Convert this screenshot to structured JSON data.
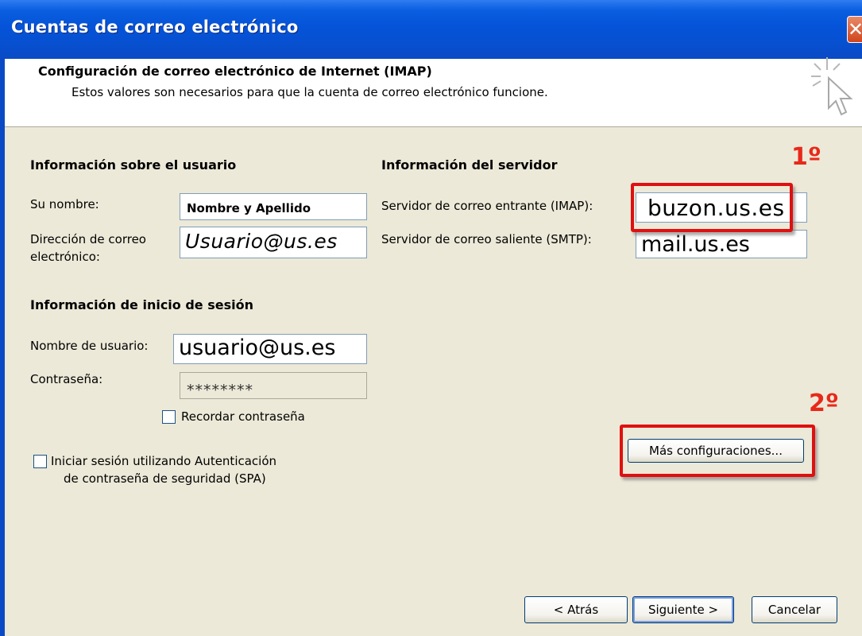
{
  "window": {
    "title": "Cuentas de correo electrónico",
    "close_label": "✕"
  },
  "header": {
    "title": "Configuración de correo electrónico de Internet (IMAP)",
    "subtitle": "Estos valores son necesarios para que la cuenta de correo electrónico funcione."
  },
  "user_info": {
    "heading": "Información sobre el usuario",
    "name_label": "Su nombre:",
    "name_value": "Nombre y Apellido",
    "email_label_line1": "Dirección de correo",
    "email_label_line2": "electrónico:",
    "email_value": "Usuario@us.es"
  },
  "server_info": {
    "heading": "Información del servidor",
    "incoming_label": "Servidor de correo entrante (IMAP):",
    "incoming_value": "buzon.us.es",
    "outgoing_label": "Servidor de correo saliente (SMTP):",
    "outgoing_value": "mail.us.es"
  },
  "login_info": {
    "heading": "Información de inicio de sesión",
    "username_label": "Nombre de usuario:",
    "username_value": "usuario@us.es",
    "password_label": "Contraseña:",
    "password_value": "********",
    "remember_label": "Recordar contraseña"
  },
  "spa": {
    "label_line1": "Iniciar sesión utilizando Autenticación",
    "label_line2": "de contraseña de seguridad (SPA)"
  },
  "annotations": {
    "step1": "1º",
    "step2": "2º"
  },
  "buttons": {
    "more_settings": "Más configuraciones...",
    "back": "< Atrás",
    "next": "Siguiente >",
    "cancel": "Cancelar"
  },
  "colors": {
    "titlebar": "#0553d8",
    "annotation_red": "#e01010",
    "dialog_bg": "#ece9d8"
  }
}
